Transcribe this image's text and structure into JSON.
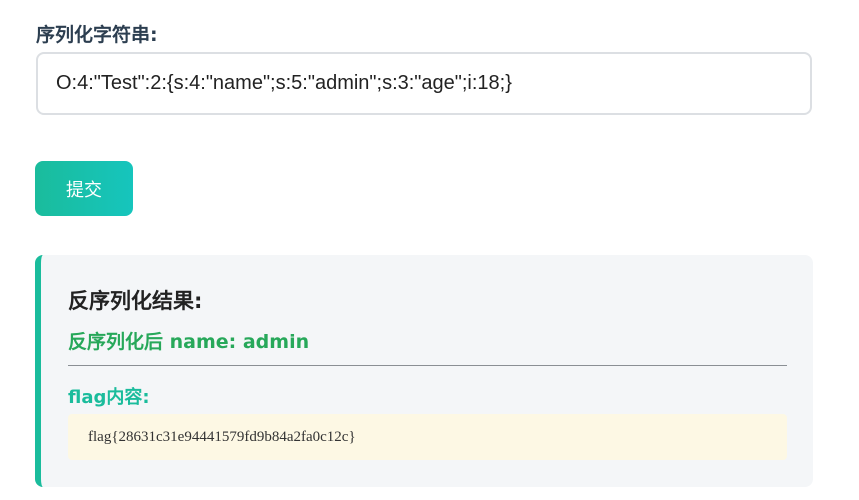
{
  "form": {
    "label": "序列化字符串:",
    "input_value": "O:4:\"Test\":2:{s:4:\"name\";s:5:\"admin\";s:3:\"age\";i:18;}",
    "submit_label": "提交"
  },
  "result": {
    "title": "反序列化结果:",
    "deserialized_text": "反序列化后 name: admin",
    "flag_label": "flag内容:",
    "flag_value": "flag{28631c31e94441579fd9b84a2fa0c12c}"
  },
  "colors": {
    "accent": "#1abc9c",
    "success_text": "#27a85a",
    "panel_bg": "#f4f6f8",
    "flag_bg": "#fdf8e4"
  }
}
